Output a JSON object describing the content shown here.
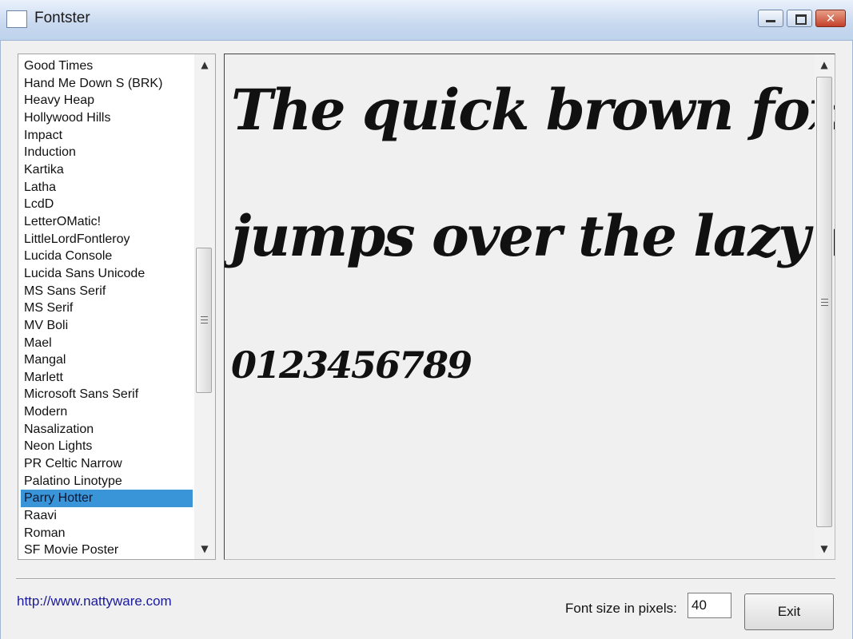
{
  "window": {
    "title": "Fontster",
    "close_glyph": "✕"
  },
  "font_list": {
    "items": [
      "Good Times",
      "Hand Me Down S (BRK)",
      "Heavy Heap",
      "Hollywood Hills",
      "Impact",
      "Induction",
      "Kartika",
      "Latha",
      "LcdD",
      "LetterOMatic!",
      "LittleLordFontleroy",
      "Lucida Console",
      "Lucida Sans Unicode",
      "MS Sans Serif",
      "MS Serif",
      "MV Boli",
      "Mael",
      "Mangal",
      "Marlett",
      "Microsoft Sans Serif",
      "Modern",
      "Nasalization",
      "Neon Lights",
      "PR Celtic Narrow",
      "Palatino Linotype",
      "Parry Hotter",
      "Raavi",
      "Roman",
      "SF Movie Poster"
    ],
    "selected_index": 25,
    "selected": "Parry Hotter",
    "selection_color": "#3a94d8"
  },
  "preview": {
    "line1": "The quick brown fox",
    "line2": "jumps over the lazy dog.",
    "line3": "0123456789"
  },
  "scroll": {
    "up_arrow": "▲",
    "down_arrow": "▼",
    "grip": "≡"
  },
  "footer": {
    "link": "http://www.nattyware.com",
    "font_size_label": "Font size in pixels:",
    "font_size_value": "40",
    "exit_label": "Exit"
  }
}
